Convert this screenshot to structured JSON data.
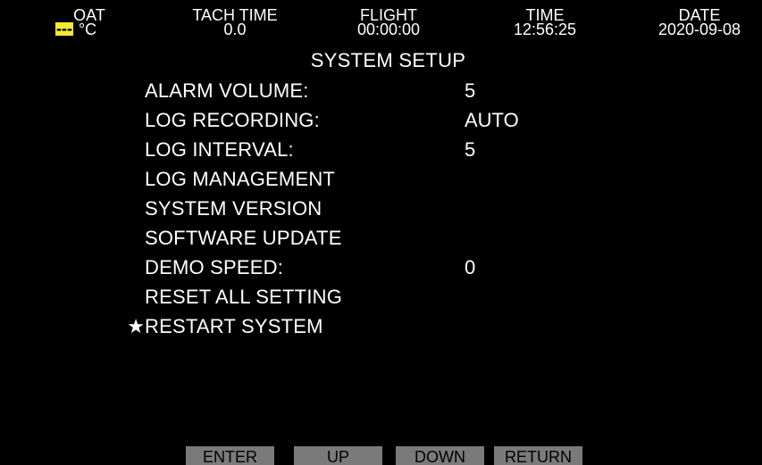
{
  "header": {
    "oat": {
      "label": "OAT",
      "value": "---",
      "unit": "°C"
    },
    "tach_time": {
      "label": "TACH TIME",
      "value": "0.0"
    },
    "flight": {
      "label": "FLIGHT",
      "value": "00:00:00"
    },
    "time": {
      "label": "TIME",
      "value": "12:56:25"
    },
    "date": {
      "label": "DATE",
      "value": "2020-09-08"
    }
  },
  "page_title": "SYSTEM SETUP",
  "menu": {
    "selected_marker": "★",
    "selected_index": 8,
    "items": [
      {
        "label": "ALARM VOLUME:",
        "value": "5"
      },
      {
        "label": "LOG RECORDING:",
        "value": "AUTO"
      },
      {
        "label": "LOG INTERVAL:",
        "value": "5"
      },
      {
        "label": "LOG MANAGEMENT",
        "value": ""
      },
      {
        "label": "SYSTEM VERSION",
        "value": ""
      },
      {
        "label": "SOFTWARE UPDATE",
        "value": ""
      },
      {
        "label": "DEMO SPEED:",
        "value": "0"
      },
      {
        "label": "RESET ALL SETTING",
        "value": ""
      },
      {
        "label": "RESTART SYSTEM",
        "value": ""
      }
    ]
  },
  "softkeys": {
    "enter": "ENTER",
    "up": "UP",
    "down": "DOWN",
    "return": "RETURN"
  },
  "colors": {
    "background": "#000000",
    "text": "#ffffff",
    "oat_highlight": "#f5e83a",
    "softkey_bg": "#7a7a7a"
  }
}
